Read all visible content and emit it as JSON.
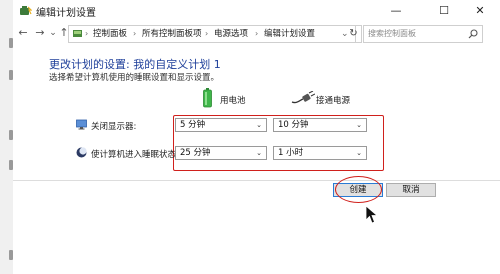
{
  "window": {
    "title": "编辑计划设置",
    "controls": {
      "minimize": "—",
      "maximize": "☐",
      "close": "✕"
    }
  },
  "nav": {
    "back": "←",
    "forward": "→",
    "recent": "⌄",
    "up": "↑",
    "breadcrumbs": [
      "控制面板",
      "所有控制面板项",
      "电源选项",
      "编辑计划设置"
    ],
    "separator": "›",
    "dropdown": "⌄",
    "refresh": "↻",
    "search_placeholder": "搜索控制面板"
  },
  "page": {
    "heading": "更改计划的设置: 我的自定义计划 1",
    "subtext": "选择希望计算机使用的睡眠设置和显示设置。",
    "columns": {
      "battery_label": "用电池",
      "plugged_label": "接通电源",
      "battery_icon": "battery-icon",
      "plug_icon": "plug-icon"
    },
    "rows": [
      {
        "label": "关闭显示器:",
        "icon": "monitor-icon",
        "battery_value": "5 分钟",
        "plugged_value": "10 分钟"
      },
      {
        "label": "使计算机进入睡眠状态:",
        "icon": "moon-icon",
        "battery_value": "25 分钟",
        "plugged_value": "1 小时"
      }
    ]
  },
  "actions": {
    "create": "创建",
    "cancel": "取消"
  },
  "colors": {
    "heading": "#1e3f9a",
    "annotation_red": "#d0201c",
    "primary_border": "#2a7bd4",
    "battery_green": "#3fb64a"
  }
}
